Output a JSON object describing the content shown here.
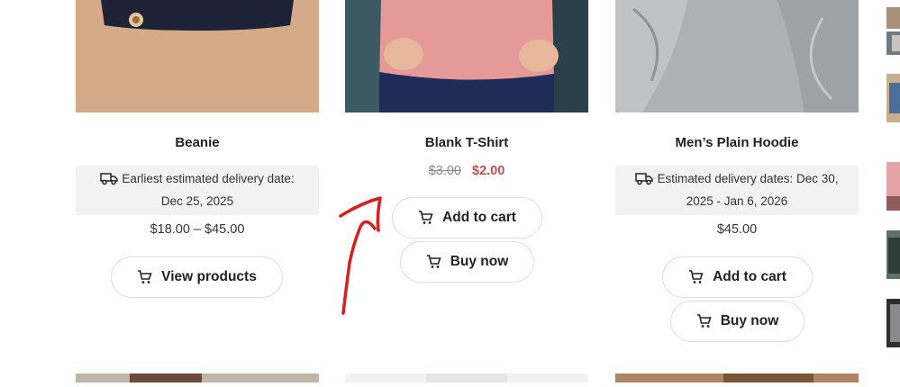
{
  "products": [
    {
      "title": "Beanie",
      "delivery": "Earliest estimated delivery date: Dec 25, 2025",
      "delivery_line1": "Earliest estimated delivery date:",
      "delivery_line2": "Dec 25, 2025",
      "price": "$18.00 – $45.00",
      "button": "View products"
    },
    {
      "title": "Blank T-Shirt",
      "old_price": "$3.00",
      "new_price": "$2.00",
      "add_to_cart": "Add to cart",
      "buy_now": "Buy now"
    },
    {
      "title": "Men’s Plain Hoodie",
      "delivery_line1": "Estimated delivery dates: Dec 30,",
      "delivery_line2": "2025 - Jan 6, 2026",
      "price": "$45.00",
      "add_to_cart": "Add to cart",
      "buy_now": "Buy now"
    }
  ],
  "colors": {
    "sale_price": "#c0504d",
    "annotation_arrow": "#d62020",
    "delivery_bg": "#f2f2f2"
  },
  "icons": [
    "truck-icon",
    "cart-icon"
  ]
}
